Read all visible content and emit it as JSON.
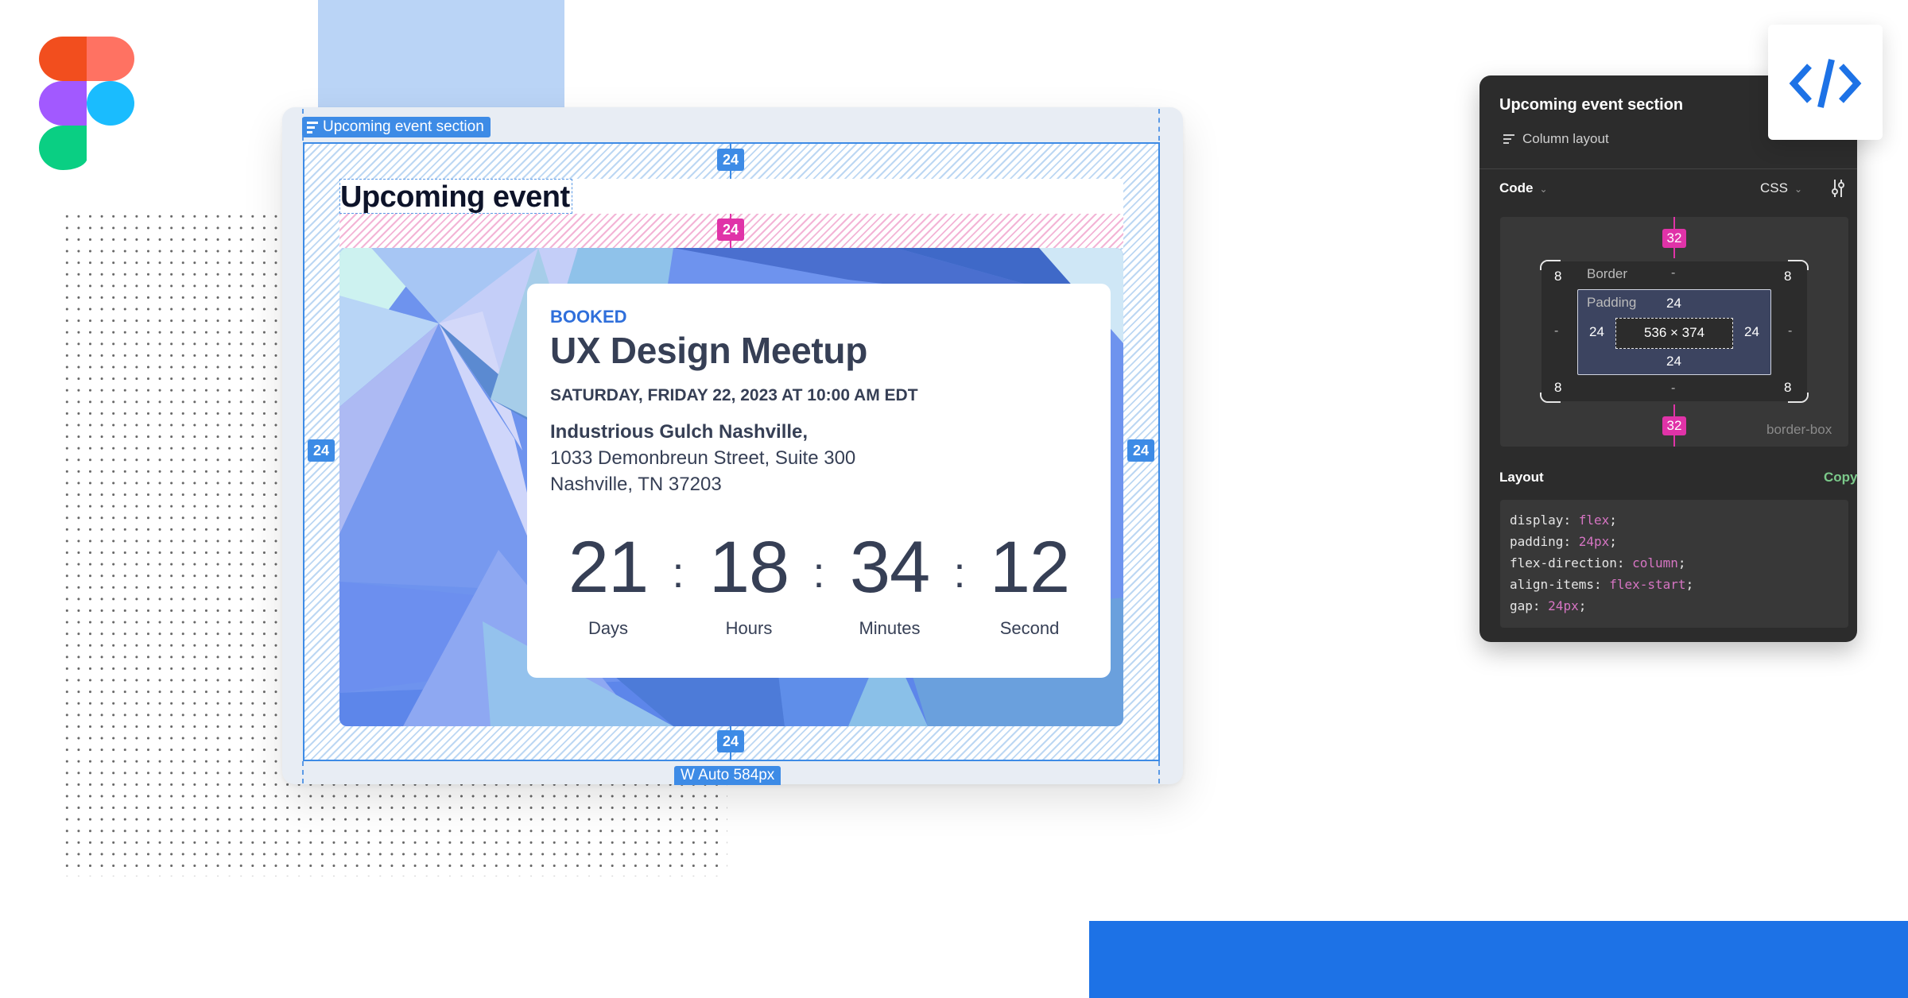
{
  "canvas": {
    "section_label": "Upcoming event section",
    "width_label": "W Auto 584px",
    "spacing": {
      "top": "24",
      "gap": "24",
      "left": "24",
      "right": "24",
      "bottom": "24"
    }
  },
  "event_section": {
    "heading": "Upcoming event",
    "card": {
      "status": "BOOKED",
      "title": "UX Design Meetup",
      "datetime": "SATURDAY, FRIDAY 22, 2023 AT 10:00 AM EDT",
      "venue": "Industrious Gulch Nashville,",
      "address_line1": "1033 Demonbreun Street,  Suite 300",
      "address_line2": "Nashville, TN 37203",
      "countdown": [
        {
          "value": "21",
          "label": "Days"
        },
        {
          "value": "18",
          "label": "Hours"
        },
        {
          "value": "34",
          "label": "Minutes"
        },
        {
          "value": "12",
          "label": "Second"
        }
      ],
      "separator": ":"
    }
  },
  "inspect_panel": {
    "title": "Upcoming event section",
    "subtitle": "Column layout",
    "code_label": "Code",
    "language": "CSS",
    "box_model": {
      "margin_top": "32",
      "margin_bottom": "32",
      "border_label": "Border",
      "border_top": "-",
      "border_bottom": "-",
      "border_left": "-",
      "border_right": "-",
      "radius_tl": "8",
      "radius_tr": "8",
      "radius_bl": "8",
      "radius_br": "8",
      "padding_label": "Padding",
      "padding_top": "24",
      "padding_bottom": "24",
      "padding_left": "24",
      "padding_right": "24",
      "content_size": "536 × 374",
      "sizing": "border-box"
    },
    "layout_label": "Layout",
    "copy_label": "Copy",
    "css": [
      {
        "prop": "display",
        "value": "flex"
      },
      {
        "prop": "padding",
        "value": "24px"
      },
      {
        "prop": "flex-direction",
        "value": "column"
      },
      {
        "prop": "align-items",
        "value": "flex-start"
      },
      {
        "prop": "gap",
        "value": "24px"
      }
    ]
  },
  "colors": {
    "selection_blue": "#3d8be6",
    "gap_pink": "#e033a8",
    "booked_blue": "#2f6fdb",
    "text_dark": "#363f55",
    "panel_bg": "#2c2c2c",
    "copy_green": "#7bc98a",
    "brand_blue": "#1d72e6"
  }
}
